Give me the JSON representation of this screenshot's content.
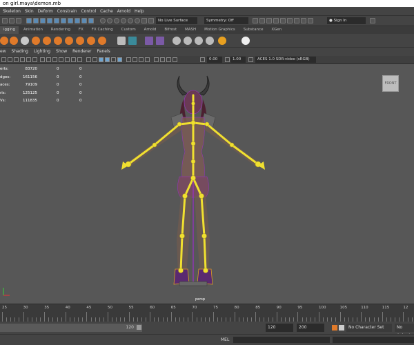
{
  "window": {
    "title": "on girl.maya\\demon.mb"
  },
  "menu": [
    "Skeleton",
    "Skin",
    "Deform",
    "Constrain",
    "Control",
    "Cache",
    "Arnold",
    "Help"
  ],
  "status_toolbar": {
    "live_surface": "No Live Surface",
    "symmetry": "Symmetry: Off",
    "sign_in": "Sign In"
  },
  "shelf_tabs": [
    {
      "label": "igging",
      "active": true
    },
    {
      "label": "Animation",
      "active": false
    },
    {
      "label": "Rendering",
      "active": false
    },
    {
      "label": "FX",
      "active": false
    },
    {
      "label": "FX Caching",
      "active": false
    },
    {
      "label": "Custom",
      "active": false
    },
    {
      "label": "Arnold",
      "active": false
    },
    {
      "label": "Bifrost",
      "active": false
    },
    {
      "label": "MASH",
      "active": false
    },
    {
      "label": "Motion Graphics",
      "active": false
    },
    {
      "label": "Substance",
      "active": false
    },
    {
      "label": "XGen",
      "active": false
    }
  ],
  "panel_menu": [
    "ew",
    "Shading",
    "Lighting",
    "Show",
    "Renderer",
    "Panels"
  ],
  "panel_toolbar": {
    "value1": "0.00",
    "value2": "1.00",
    "color_space": "ACES 1.0 SDR-video (sRGB)"
  },
  "hud": [
    {
      "label": "erts:",
      "v1": "83720",
      "v2": "0",
      "v3": "0"
    },
    {
      "label": "dges:",
      "v1": "161156",
      "v2": "0",
      "v3": "0"
    },
    {
      "label": "aces:",
      "v1": "79109",
      "v2": "0",
      "v3": "0"
    },
    {
      "label": "ris:",
      "v1": "125125",
      "v2": "0",
      "v3": "0"
    },
    {
      "label": "Vs:",
      "v1": "111835",
      "v2": "0",
      "v3": "0"
    }
  ],
  "viewport": {
    "view_cube_label": "FRONT",
    "camera_label": "persp"
  },
  "timeline": {
    "ticks": [
      "25",
      "30",
      "35",
      "40",
      "45",
      "50",
      "55",
      "60",
      "65",
      "70",
      "75",
      "80",
      "85",
      "90",
      "95",
      "100",
      "105",
      "110",
      "115",
      "12"
    ]
  },
  "range": {
    "end_inner": "120",
    "end_field": "120",
    "max_field": "200",
    "character_set": "No Character Set",
    "anim_layer": "No Anim L"
  },
  "command_line": {
    "label": "MEL"
  },
  "colors": {
    "viewport_bg": "#575757",
    "joint": "#f0e030",
    "bone_outline": "#9b2fc9"
  }
}
